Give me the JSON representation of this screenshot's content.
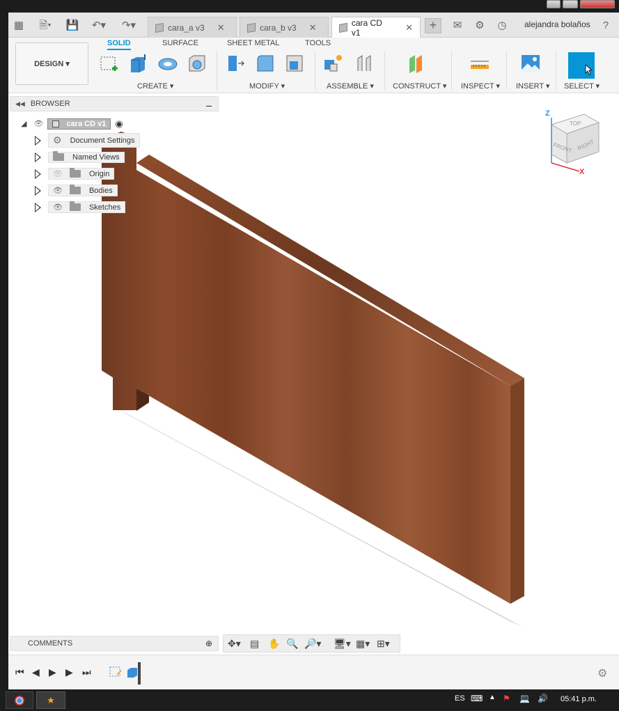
{
  "tabs": [
    {
      "label": "cara_a v3",
      "active": false
    },
    {
      "label": "cara_b v3",
      "active": false
    },
    {
      "label": "cara CD v1",
      "active": true
    }
  ],
  "user": {
    "name": "alejandra bolaños"
  },
  "ribbon": {
    "workspace": "DESIGN",
    "tabs": [
      "SOLID",
      "SURFACE",
      "SHEET METAL",
      "TOOLS"
    ],
    "groups": {
      "create": "CREATE",
      "modify": "MODIFY",
      "assemble": "ASSEMBLE",
      "construct": "CONSTRUCT",
      "inspect": "INSPECT",
      "insert": "INSERT",
      "select": "SELECT"
    }
  },
  "browser": {
    "title": "BROWSER",
    "root": "cara CD v1",
    "items": [
      {
        "label": "Document Settings",
        "icon": "gear-icon"
      },
      {
        "label": "Named Views",
        "icon": "folder-icon"
      },
      {
        "label": "Origin",
        "icon": "folder-icon"
      },
      {
        "label": "Bodies",
        "icon": "folder-icon"
      },
      {
        "label": "Sketches",
        "icon": "folder-icon"
      }
    ]
  },
  "viewcube": {
    "top": "TOP",
    "front": "FRONT",
    "right": "RIGHT",
    "axis_z": "Z",
    "axis_x": "X"
  },
  "comments": {
    "title": "COMMENTS"
  },
  "taskbar": {
    "lang": "ES",
    "time": "05:41 p.m."
  },
  "colors": {
    "accent": "#0696d7",
    "wood": "#8b4a2b"
  }
}
